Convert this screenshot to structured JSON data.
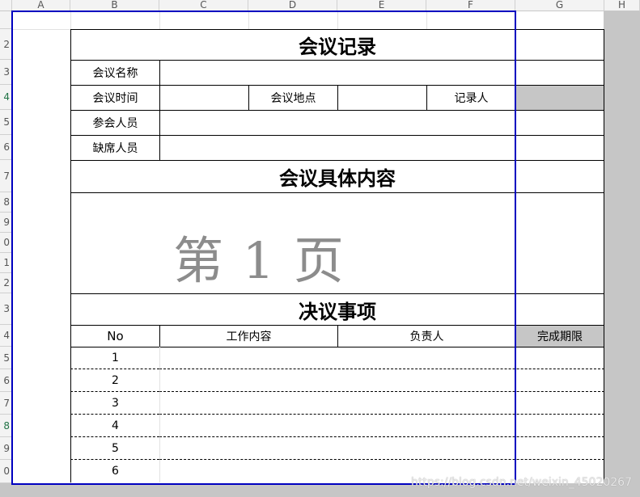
{
  "columns": [
    "A",
    "B",
    "C",
    "D",
    "E",
    "F",
    "G",
    "H"
  ],
  "rows": [
    "2",
    "3",
    "4",
    "5",
    "6",
    "7",
    "8",
    "9",
    "0",
    "1",
    "2",
    "3",
    "4",
    "5",
    "6",
    "7",
    "8",
    "9",
    "0"
  ],
  "form": {
    "title": "会议记录",
    "meeting_name_label": "会议名称",
    "meeting_time_label": "会议时间",
    "meeting_place_label": "会议地点",
    "recorder_label": "记录人",
    "attendees_label": "参会人员",
    "absentees_label": "缺席人员",
    "content_heading": "会议具体内容",
    "page_watermark": "第 1 页",
    "resolutions_heading": "决议事项",
    "table_headers": {
      "no": "No",
      "work": "工作内容",
      "owner": "负责人",
      "deadline": "完成期限"
    },
    "table_rows": [
      "1",
      "2",
      "3",
      "4",
      "5",
      "6"
    ]
  },
  "watermark_url": "https://blog.csdn.net/weixin_45020267",
  "colors": {
    "print_area_border": "#0000c0",
    "sheet_bg": "#ffffff",
    "app_bg": "#c6c6c6"
  }
}
